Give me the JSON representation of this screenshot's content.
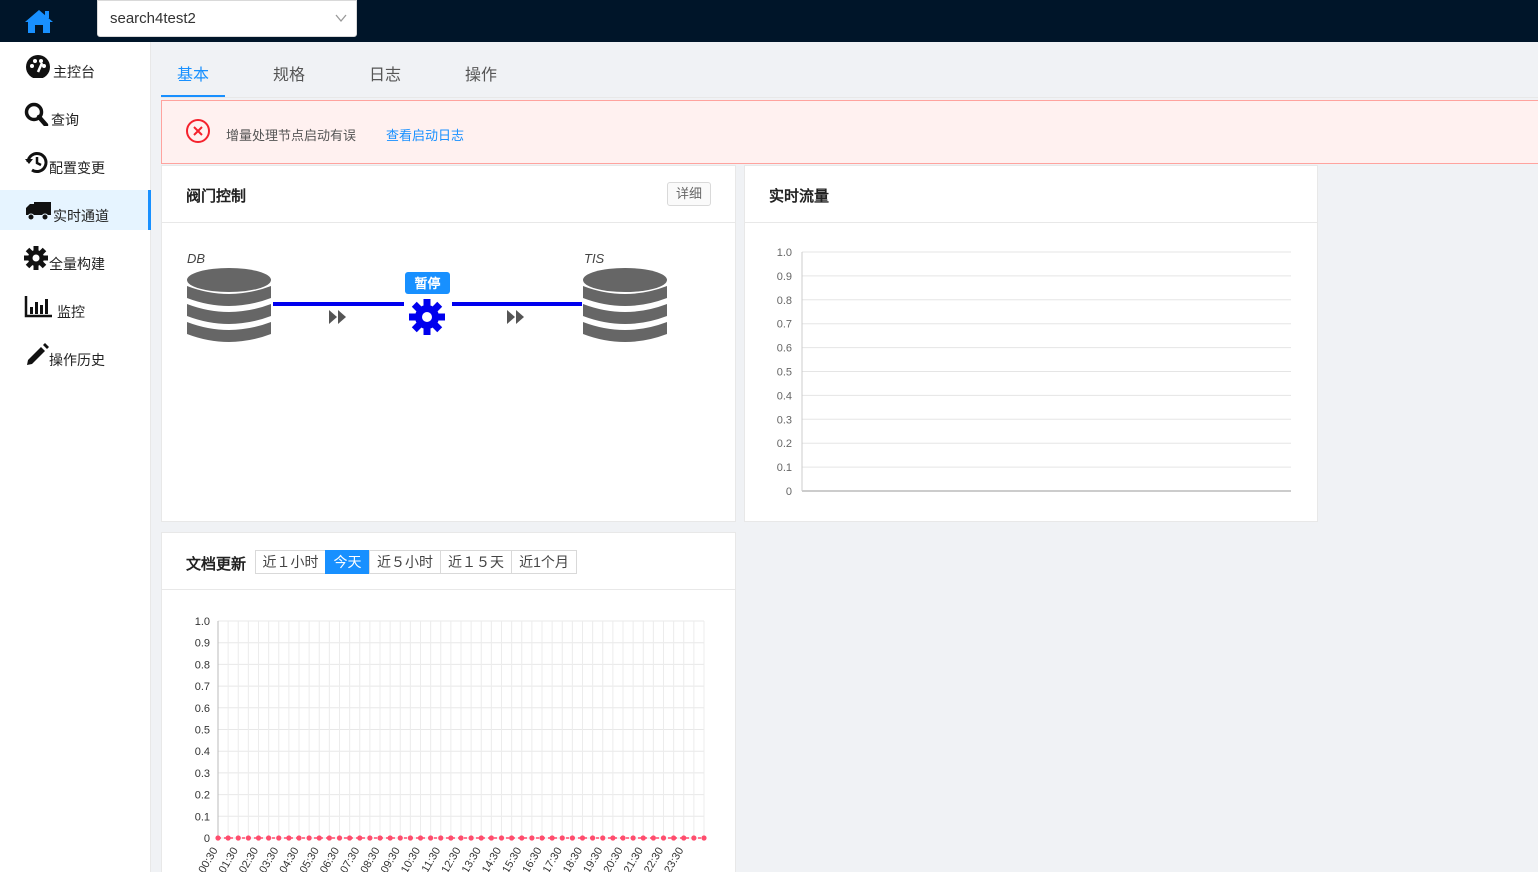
{
  "app_select": {
    "value": "search4test2"
  },
  "sidebar": {
    "items": [
      {
        "label": "主控台",
        "icon": "dashboard-icon"
      },
      {
        "label": "查询",
        "icon": "search-icon"
      },
      {
        "label": "配置变更",
        "icon": "history-icon"
      },
      {
        "label": "实时通道",
        "icon": "truck-icon",
        "active": true
      },
      {
        "label": "全量构建",
        "icon": "gear-icon"
      },
      {
        "label": "监控",
        "icon": "bar-chart-icon"
      },
      {
        "label": "操作历史",
        "icon": "pencil-icon"
      }
    ]
  },
  "tabs": [
    {
      "label": "基本",
      "active": true
    },
    {
      "label": "规格"
    },
    {
      "label": "日志"
    },
    {
      "label": "操作"
    }
  ],
  "alert": {
    "message": "增量处理节点启动有误",
    "link": "查看启动日志"
  },
  "valve": {
    "title": "阀门控制",
    "detail_button": "详细",
    "source_label": "DB",
    "target_label": "TIS",
    "status": "暂停"
  },
  "flow": {
    "title": "实时流量"
  },
  "doc_update": {
    "title": "文档更新",
    "ranges": [
      {
        "label": "近１小时"
      },
      {
        "label": "今天",
        "active": true
      },
      {
        "label": "近５小时"
      },
      {
        "label": "近１５天"
      },
      {
        "label": "近1个月"
      }
    ]
  },
  "colors": {
    "accent": "#1890ff",
    "topbar": "#001529",
    "series": "#ff4d6d",
    "error": "#f5222d"
  },
  "chart_data": [
    {
      "type": "line",
      "title": "实时流量",
      "x": [],
      "series": [],
      "ylim": [
        0,
        1.0
      ],
      "yticks": [
        "1.0",
        "0.9",
        "0.8",
        "0.7",
        "0.6",
        "0.5",
        "0.4",
        "0.3",
        "0.2",
        "0.1",
        "0"
      ],
      "grid": true
    },
    {
      "type": "line",
      "title": "文档更新",
      "categories": [
        "00:30",
        "01:30",
        "02:30",
        "03:30",
        "04:30",
        "05:30",
        "06:30",
        "07:30",
        "08:30",
        "09:30",
        "10:30",
        "11:30",
        "12:30",
        "13:30",
        "14:30",
        "15:30",
        "16:30",
        "17:30",
        "18:30",
        "19:30",
        "20:30",
        "21:30",
        "22:30",
        "23:30"
      ],
      "series": [
        {
          "values": [
            0,
            0,
            0,
            0,
            0,
            0,
            0,
            0,
            0,
            0,
            0,
            0,
            0,
            0,
            0,
            0,
            0,
            0,
            0,
            0,
            0,
            0,
            0,
            0,
            0,
            0,
            0,
            0,
            0,
            0,
            0,
            0,
            0,
            0,
            0,
            0,
            0,
            0,
            0,
            0,
            0,
            0,
            0,
            0,
            0,
            0,
            0,
            0,
            0
          ]
        }
      ],
      "ylim": [
        0,
        1.0
      ],
      "yticks": [
        "1.0",
        "0.9",
        "0.8",
        "0.7",
        "0.6",
        "0.5",
        "0.4",
        "0.3",
        "0.2",
        "0.1",
        "0"
      ],
      "grid": true
    }
  ]
}
